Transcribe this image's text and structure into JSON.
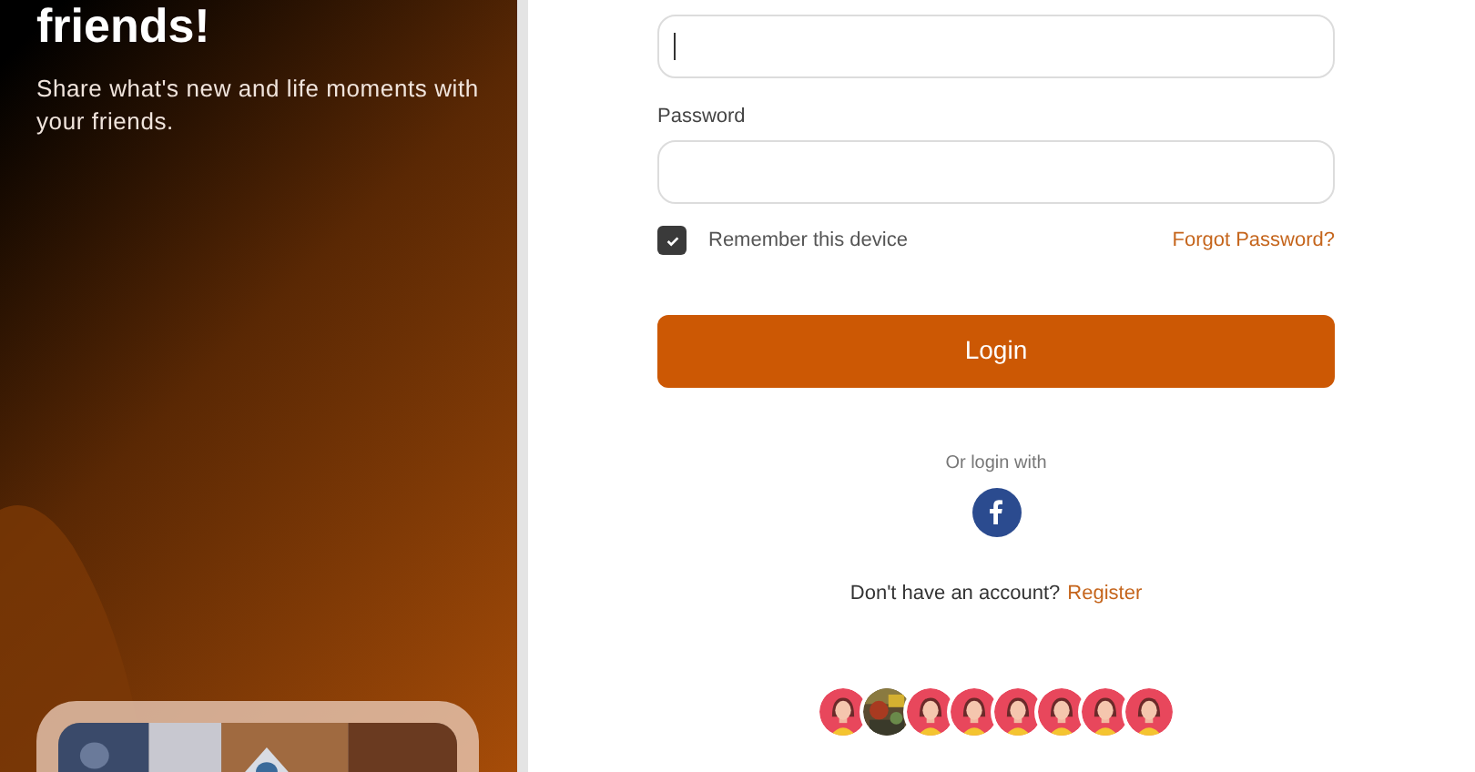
{
  "hero": {
    "title": "friends!",
    "subtitle": "Share what's new and life moments with your friends."
  },
  "form": {
    "email_field": {
      "focused": true
    },
    "password": {
      "label": "Password"
    },
    "remember": {
      "label": "Remember this device",
      "checked": true
    },
    "forgot_link": "Forgot Password?",
    "login_button": "Login",
    "social_caption": "Or login with",
    "register": {
      "text": "Don't have an account?",
      "link": "Register"
    }
  },
  "avatars": [
    {
      "kind": "avatar"
    },
    {
      "kind": "picture"
    },
    {
      "kind": "avatar"
    },
    {
      "kind": "avatar"
    },
    {
      "kind": "avatar"
    },
    {
      "kind": "avatar"
    },
    {
      "kind": "avatar"
    },
    {
      "kind": "avatar"
    }
  ]
}
